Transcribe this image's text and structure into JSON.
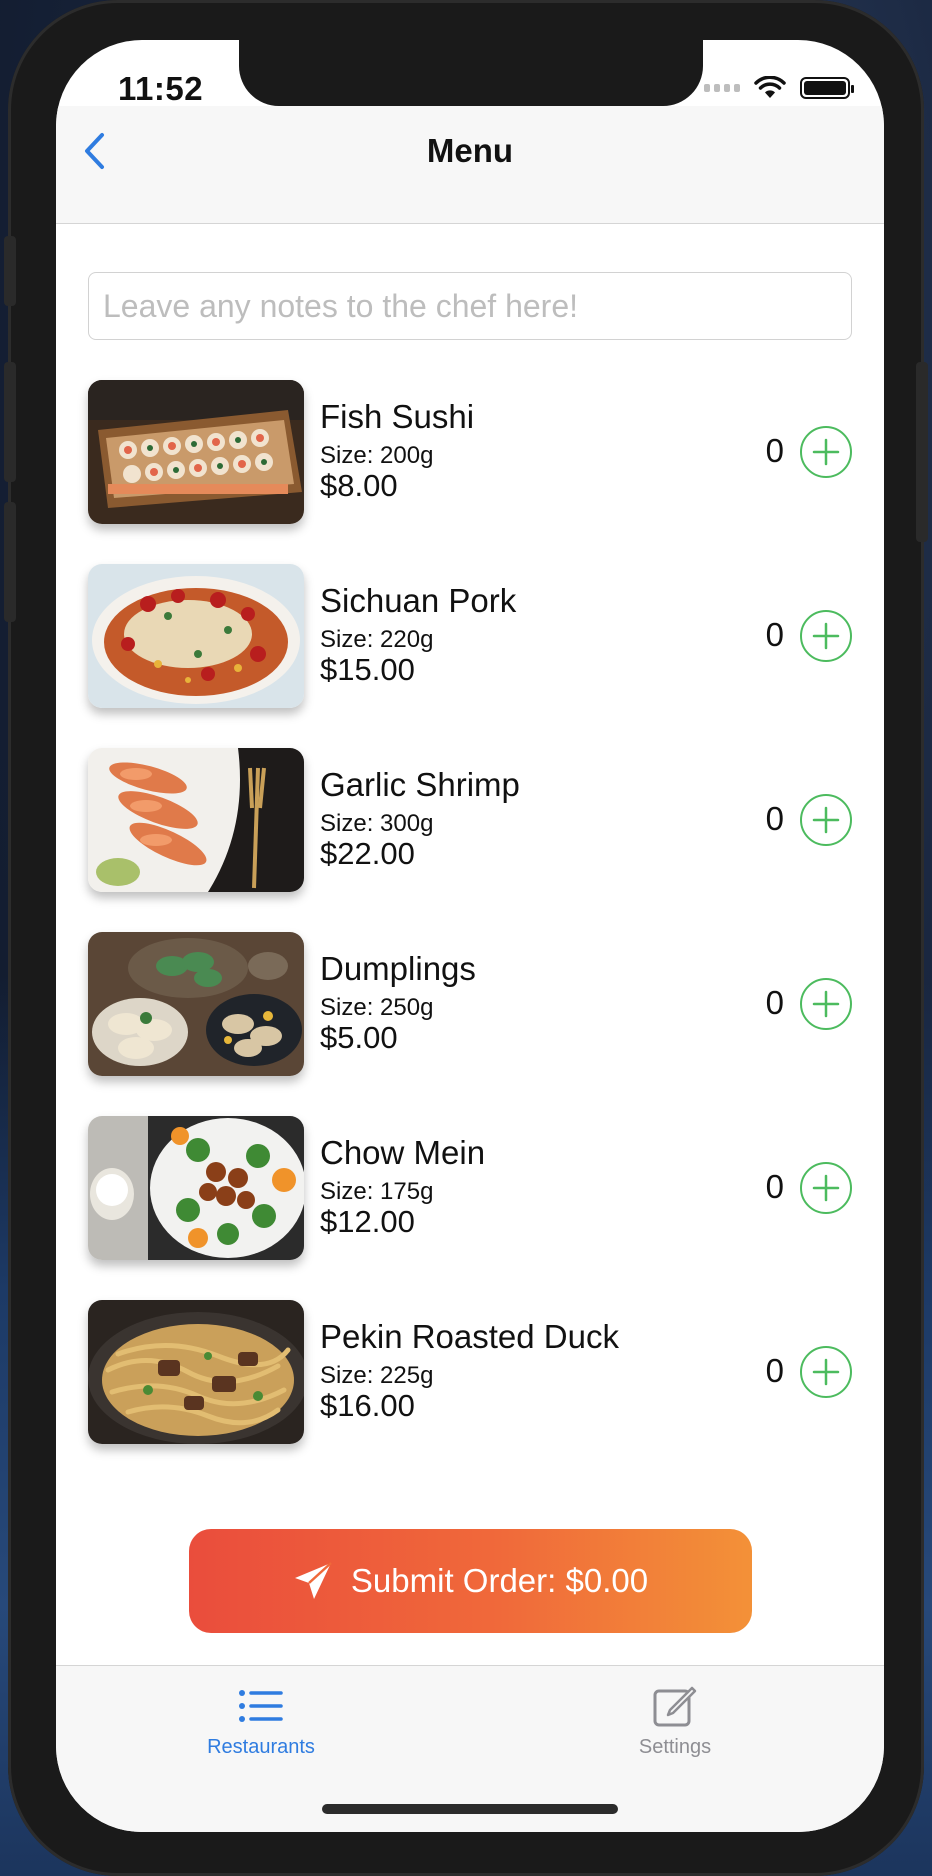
{
  "status_bar": {
    "time": "11:52"
  },
  "nav": {
    "title": "Menu",
    "back_icon": "chevron-left-icon"
  },
  "notes": {
    "placeholder": "Leave any notes to the chef here!",
    "value": ""
  },
  "menu_items": [
    {
      "name": "Fish Sushi",
      "size": "Size: 200g",
      "price": "$8.00",
      "quantity": "0"
    },
    {
      "name": "Sichuan Pork",
      "size": "Size: 220g",
      "price": "$15.00",
      "quantity": "0"
    },
    {
      "name": "Garlic Shrimp",
      "size": "Size: 300g",
      "price": "$22.00",
      "quantity": "0"
    },
    {
      "name": "Dumplings",
      "size": "Size: 250g",
      "price": "$5.00",
      "quantity": "0"
    },
    {
      "name": "Chow Mein",
      "size": "Size: 175g",
      "price": "$12.00",
      "quantity": "0"
    },
    {
      "name": "Pekin Roasted Duck",
      "size": "Size: 225g",
      "price": "$16.00",
      "quantity": "0"
    }
  ],
  "submit": {
    "label": "Submit Order: $0.00",
    "icon": "paper-plane-icon"
  },
  "tabs": [
    {
      "label": "Restaurants",
      "icon": "list-icon",
      "active": true
    },
    {
      "label": "Settings",
      "icon": "edit-icon",
      "active": false
    }
  ],
  "colors": {
    "accent_blue": "#2f7ce0",
    "add_green": "#4cbb5e",
    "submit_gradient_start": "#ea4d3c",
    "submit_gradient_end": "#f39138",
    "inactive_gray": "#8e8e93"
  }
}
